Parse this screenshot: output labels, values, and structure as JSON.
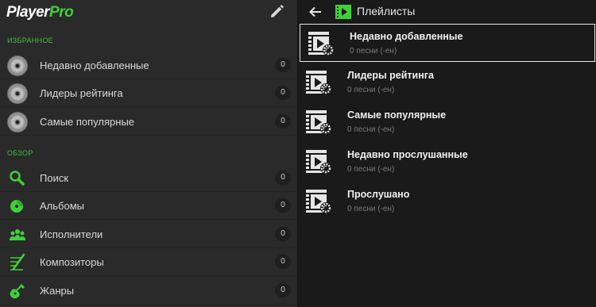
{
  "app": {
    "logo_player": "Player",
    "logo_pro": "Pro"
  },
  "sidebar": {
    "favorites_header": "ИЗБРАННОЕ",
    "favorites": [
      {
        "label": "Недавно добавленные",
        "count": "0",
        "icon": "disc-icon"
      },
      {
        "label": "Лидеры рейтинга",
        "count": "0",
        "icon": "disc-icon"
      },
      {
        "label": "Самые популярные",
        "count": "0",
        "icon": "disc-icon"
      }
    ],
    "browse_header": "ОБЗОР",
    "browse": [
      {
        "label": "Поиск",
        "count": "0",
        "icon": "search-icon"
      },
      {
        "label": "Альбомы",
        "count": "0",
        "icon": "album-icon"
      },
      {
        "label": "Исполнители",
        "count": "0",
        "icon": "artists-icon"
      },
      {
        "label": "Композиторы",
        "count": "0",
        "icon": "composer-icon"
      },
      {
        "label": "Жанры",
        "count": "0",
        "icon": "guitar-icon"
      }
    ]
  },
  "main": {
    "title": "Плейлисты",
    "playlists": [
      {
        "title": "Недавно добавленные",
        "subtitle": "0 песни (-ен)",
        "selected": true
      },
      {
        "title": "Лидеры рейтинга",
        "subtitle": "0 песни (-ен)",
        "selected": false
      },
      {
        "title": "Самые популярные",
        "subtitle": "0 песни (-ен)",
        "selected": false
      },
      {
        "title": "Недавно прослушанные",
        "subtitle": "0 песни (-ен)",
        "selected": false
      },
      {
        "title": "Прослушано",
        "subtitle": "0 песни (-ен)",
        "selected": false
      }
    ]
  },
  "colors": {
    "accent": "#3fd13a",
    "sidebar_bg": "#2a2a2a",
    "main_bg": "#1a1a1a"
  }
}
